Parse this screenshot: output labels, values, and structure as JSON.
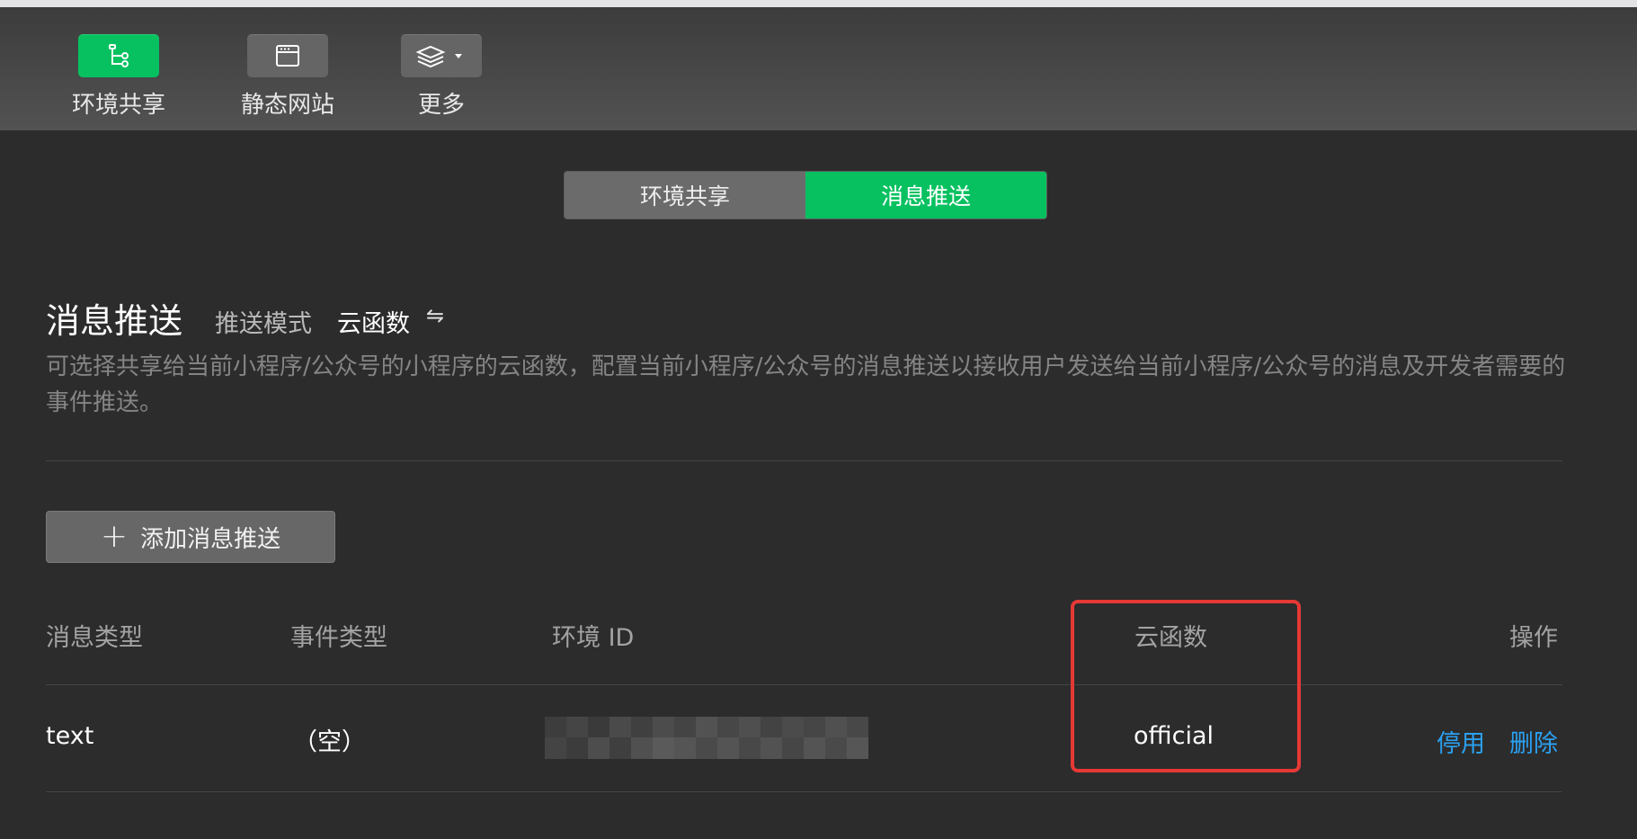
{
  "toolbar": {
    "env_share": {
      "label": "环境共享",
      "icon": "tree-icon"
    },
    "static_site": {
      "label": "静态网站",
      "icon": "window-icon"
    },
    "more": {
      "label": "更多",
      "icon": "layers-icon"
    }
  },
  "tabs": [
    {
      "label": "环境共享",
      "active": false
    },
    {
      "label": "消息推送",
      "active": true
    }
  ],
  "section": {
    "title": "消息推送",
    "mode_label": "推送模式",
    "mode_value": "云函数",
    "swap_icon": "⇋",
    "description": "可选择共享给当前小程序/公众号的小程序的云函数，配置当前小程序/公众号的消息推送以接收用户发送给当前小程序/公众号的消息及开发者需要的事件推送。"
  },
  "add_button": {
    "label": "添加消息推送"
  },
  "table": {
    "headers": {
      "msg_type": "消息类型",
      "event_type": "事件类型",
      "env_id": "环境 ID",
      "cloud_fn": "云函数",
      "actions": "操作"
    },
    "rows": [
      {
        "msg_type": "text",
        "event_type": "（空）",
        "env_id_obscured": true,
        "cloud_fn": "official",
        "disable": "停用",
        "delete": "删除"
      }
    ]
  },
  "colors": {
    "accent_green": "#07c160",
    "link_blue": "#2aa1f2",
    "highlight_red": "#e53935",
    "background": "#2c2c2c"
  }
}
